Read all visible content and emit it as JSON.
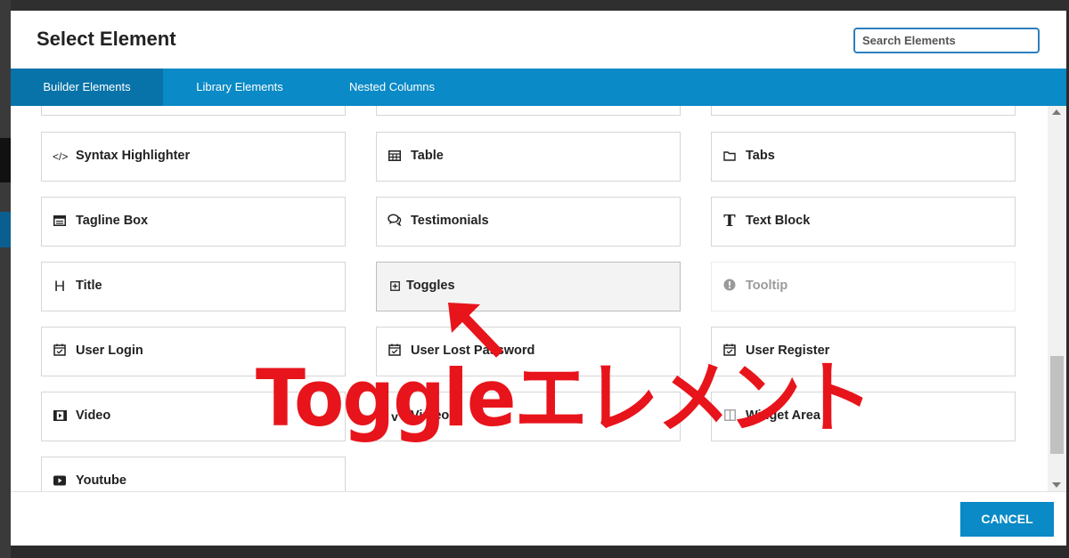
{
  "modal": {
    "title": "Select Element",
    "search_placeholder": "Search Elements",
    "cancel_label": "CANCEL"
  },
  "tabs": [
    {
      "label": "Builder Elements",
      "active": true
    },
    {
      "label": "Library Elements",
      "active": false
    },
    {
      "label": "Nested Columns",
      "active": false
    }
  ],
  "elements": [
    {
      "label": "Syntax Highlighter",
      "icon": "code-icon"
    },
    {
      "label": "Table",
      "icon": "table-icon"
    },
    {
      "label": "Tabs",
      "icon": "folder-icon"
    },
    {
      "label": "Tagline Box",
      "icon": "tagline-box-icon"
    },
    {
      "label": "Testimonials",
      "icon": "chat-bubbles-icon"
    },
    {
      "label": "Text Block",
      "icon": "text-t-icon"
    },
    {
      "label": "Title",
      "icon": "heading-h-icon"
    },
    {
      "label": "Toggles",
      "icon": "plus-square-icon",
      "state": "hover"
    },
    {
      "label": "Tooltip",
      "icon": "exclamation-circle-icon",
      "state": "disabled"
    },
    {
      "label": "User Login",
      "icon": "calendar-check-icon"
    },
    {
      "label": "User Lost Password",
      "icon": "calendar-check-icon"
    },
    {
      "label": "User Register",
      "icon": "calendar-check-icon"
    },
    {
      "label": "Video",
      "icon": "film-icon"
    },
    {
      "label": "Vimeo",
      "icon": "vimeo-icon"
    },
    {
      "label": "Widget Area",
      "icon": "columns-icon"
    },
    {
      "label": "Youtube",
      "icon": "youtube-play-icon"
    }
  ],
  "annotation": {
    "text": "Toggleエレメント",
    "color": "#e8141b"
  },
  "colors": {
    "accent": "#0a8ac6",
    "active_tab": "#0773a9"
  }
}
